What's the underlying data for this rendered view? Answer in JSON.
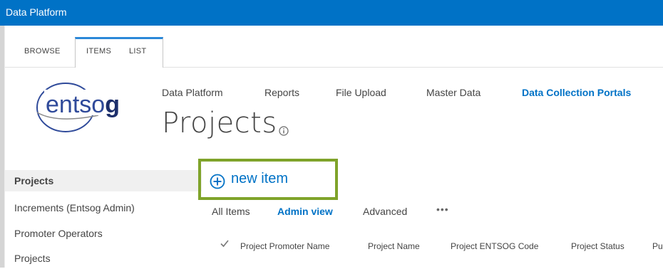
{
  "suitebar": {
    "title": "Data Platform"
  },
  "ribbon": {
    "tabs": [
      "BROWSE",
      "ITEMS",
      "LIST"
    ]
  },
  "logo": {
    "text_main": "entso",
    "text_accent": "g"
  },
  "topnav": {
    "items": [
      "Data Platform",
      "Reports",
      "File Upload",
      "Master Data",
      "Data Collection Portals"
    ],
    "selected": "Data Collection Portals"
  },
  "page": {
    "title": "Projects"
  },
  "leftnav": {
    "items": [
      "Projects",
      "Increments (Entsog Admin)",
      "Promoter Operators",
      "Projects"
    ]
  },
  "toolbar": {
    "new_item_label": "new item"
  },
  "views": {
    "items": [
      "All Items",
      "Admin view",
      "Advanced"
    ],
    "more": "•••"
  },
  "table": {
    "columns": [
      "Project Promoter Name",
      "Project Name",
      "Project ENTSOG Code",
      "Project Status",
      "Pu"
    ]
  },
  "colors": {
    "suitebar": "#0072c6",
    "accent": "#0072c6",
    "highlight_box": "#7fa32a"
  }
}
